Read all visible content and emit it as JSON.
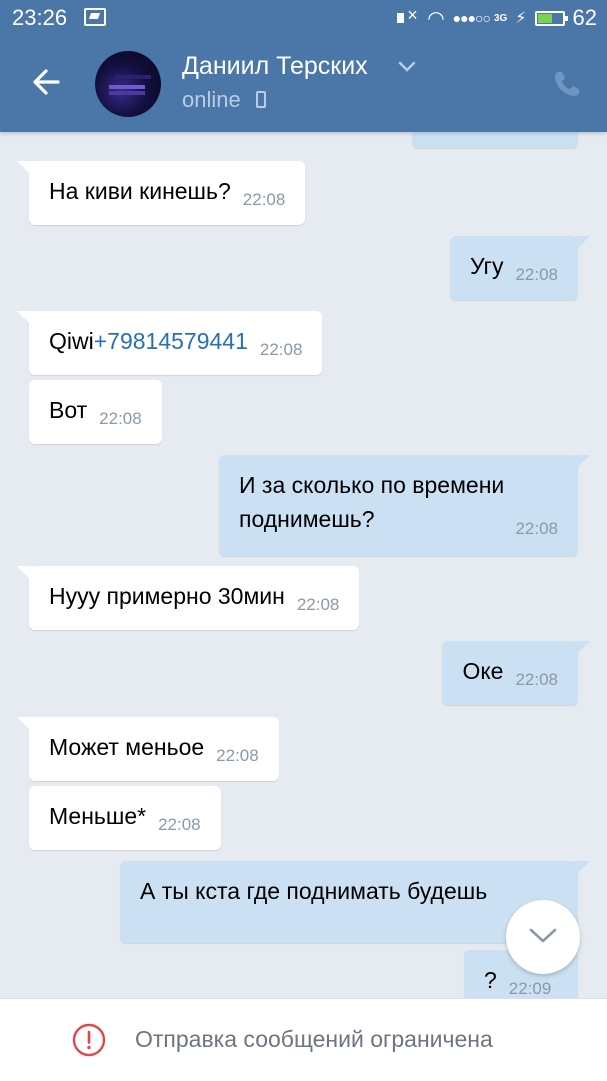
{
  "status_bar": {
    "time": "23:26",
    "network": "3G",
    "battery": "62",
    "battery_level_percent": 62
  },
  "header": {
    "contact_name": "Даниил Терских",
    "status": "online",
    "icons": [
      "back-arrow-icon",
      "chevron-down-icon",
      "mobile-icon",
      "phone-icon"
    ],
    "accent_color": "#4a76a8"
  },
  "messages": [
    {
      "dir": "out",
      "text": "",
      "time": "22:08",
      "partial": true
    },
    {
      "dir": "in",
      "text": "На киви кинешь?",
      "time": "22:08"
    },
    {
      "dir": "out",
      "text": "Угу",
      "time": "22:08"
    },
    {
      "dir": "in",
      "text": "Qiwi",
      "link": "+79814579441",
      "time": "22:08"
    },
    {
      "dir": "in",
      "text": "Вот",
      "time": "22:08"
    },
    {
      "dir": "out",
      "text": "И за сколько по времени поднимешь?",
      "time": "22:08"
    },
    {
      "dir": "in",
      "text": "Нууу примерно 30мин",
      "time": "22:08"
    },
    {
      "dir": "out",
      "text": "Оке",
      "time": "22:08"
    },
    {
      "dir": "in",
      "text": "Может меньое",
      "time": "22:08"
    },
    {
      "dir": "in",
      "text": "Меньше*",
      "time": "22:08"
    },
    {
      "dir": "out",
      "text": "А ты кста где поднимать будешь",
      "time": ""
    },
    {
      "dir": "out",
      "text": "?",
      "time": "22:09"
    }
  ],
  "bottom_bar": {
    "restriction_text": "Отправка сообщений ограничена",
    "icon": "warning-icon",
    "warning_color": "#e64646"
  }
}
